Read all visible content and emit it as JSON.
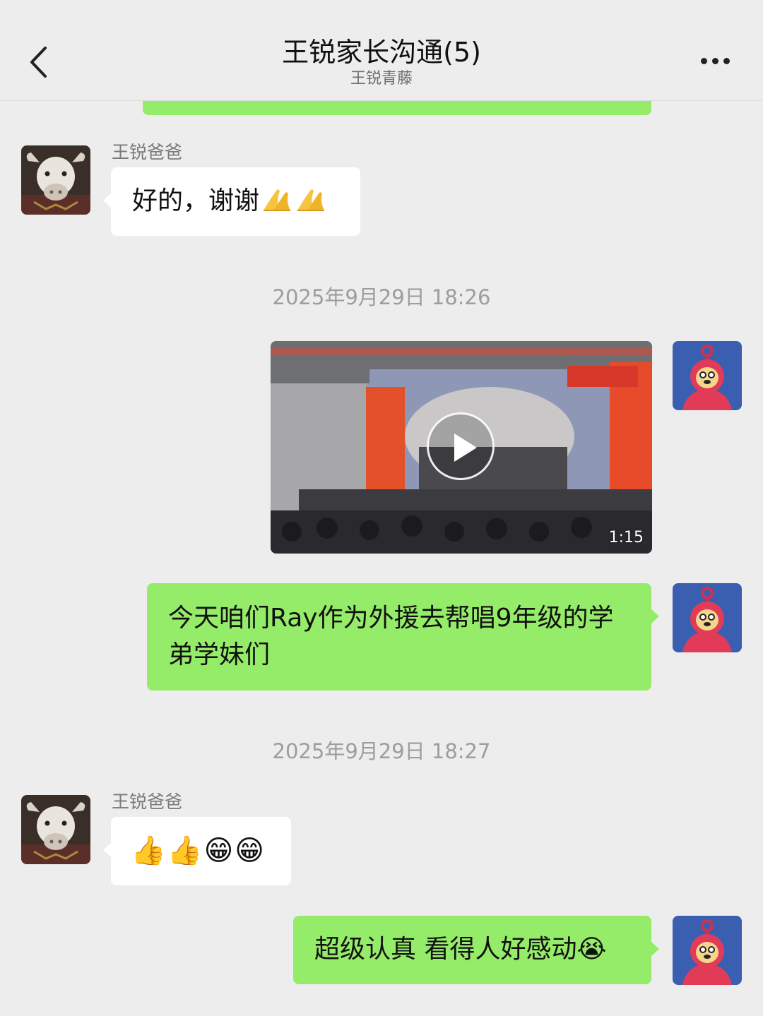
{
  "header": {
    "title": "王锐家长沟通(5)",
    "subtitle": "王锐青藤",
    "back_icon": "chevron-left-icon",
    "more_icon": "more-dots-icon"
  },
  "messages": [
    {
      "side": "left",
      "sender": "王锐爸爸",
      "text": "好的，谢谢",
      "emoji": [
        "folded-hands",
        "folded-hands"
      ]
    },
    {
      "type": "timestamp",
      "text": "2025年9月29日 18:26"
    },
    {
      "side": "right",
      "type": "video",
      "duration": "1:15"
    },
    {
      "side": "right",
      "text": "今天咱们Ray作为外援去帮唱9年级的学弟学妹们"
    },
    {
      "type": "timestamp",
      "text": "2025年9月29日 18:27"
    },
    {
      "side": "left",
      "sender": "王锐爸爸",
      "text": "👍👍😁😁"
    },
    {
      "side": "right",
      "text": "超级认真 看得人好感动😭"
    }
  ],
  "colors": {
    "background": "#ededed",
    "self_bubble": "#95ec69",
    "other_bubble": "#ffffff"
  }
}
